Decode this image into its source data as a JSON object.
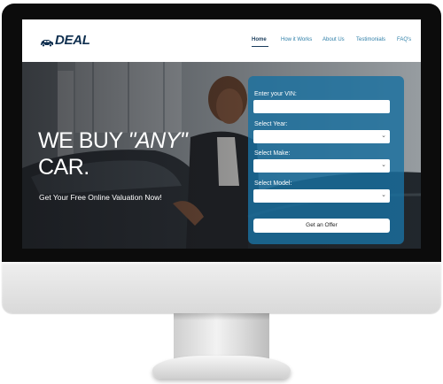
{
  "brand": {
    "logo_text": "DEAL"
  },
  "nav": {
    "items": [
      "Home",
      "How it Works",
      "About Us",
      "Testimonials",
      "FAQ's"
    ],
    "active": "Home",
    "active_color": "#1b3d5c",
    "link_color": "#2e7fa8"
  },
  "hero": {
    "headline_line1_prefix": "WE BUY ",
    "headline_line1_any": "\"ANY\"",
    "headline_line2": "CAR.",
    "subheadline": "Get Your Free Online Valuation Now!"
  },
  "form": {
    "panel_color": "#1a70a0",
    "vin_label": "Enter your VIN:",
    "vin_value": "",
    "year_label": "Select Year:",
    "year_value": "",
    "make_label": "Select Make:",
    "make_value": "",
    "model_label": "Select Model:",
    "model_value": "",
    "submit_label": "Get an Offer"
  }
}
